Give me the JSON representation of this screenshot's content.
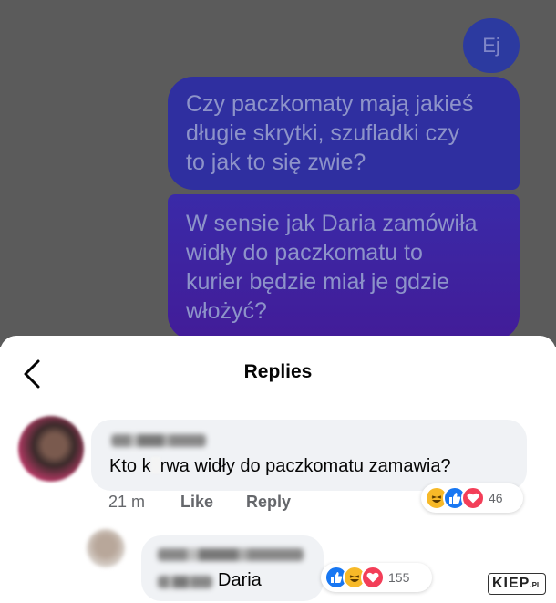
{
  "chat": {
    "bubble_ej": "Ej",
    "bubble_1_lines": [
      "Czy paczkomaty mają jakieś",
      "długie skrytki, szufladki czy",
      "to jak to się zwie?"
    ],
    "bubble_2_lines": [
      "W sensie jak Daria zamówiła",
      "widły do paczkomatu to",
      "kurier będzie miał je gdzie",
      "włożyć?"
    ]
  },
  "sheet": {
    "title": "Replies",
    "back_icon": "chevron-left-icon"
  },
  "comments": [
    {
      "text_before": "Kto k",
      "text_after": "rwa widły do paczkomatu zamawia?",
      "time": "21 m",
      "like_label": "Like",
      "reply_label": "Reply",
      "reactions": [
        "haha",
        "like",
        "love"
      ],
      "reaction_count": "46"
    },
    {
      "text": "Daria",
      "reactions": [
        "like",
        "haha",
        "love"
      ],
      "reaction_count": "155"
    }
  ],
  "watermark": {
    "main": "KIEP",
    "suffix": ".PL"
  },
  "colors": {
    "like": "#1877f2",
    "haha": "#f7b928",
    "love": "#f33e58",
    "messenger_blue": "#2f2fa0"
  }
}
